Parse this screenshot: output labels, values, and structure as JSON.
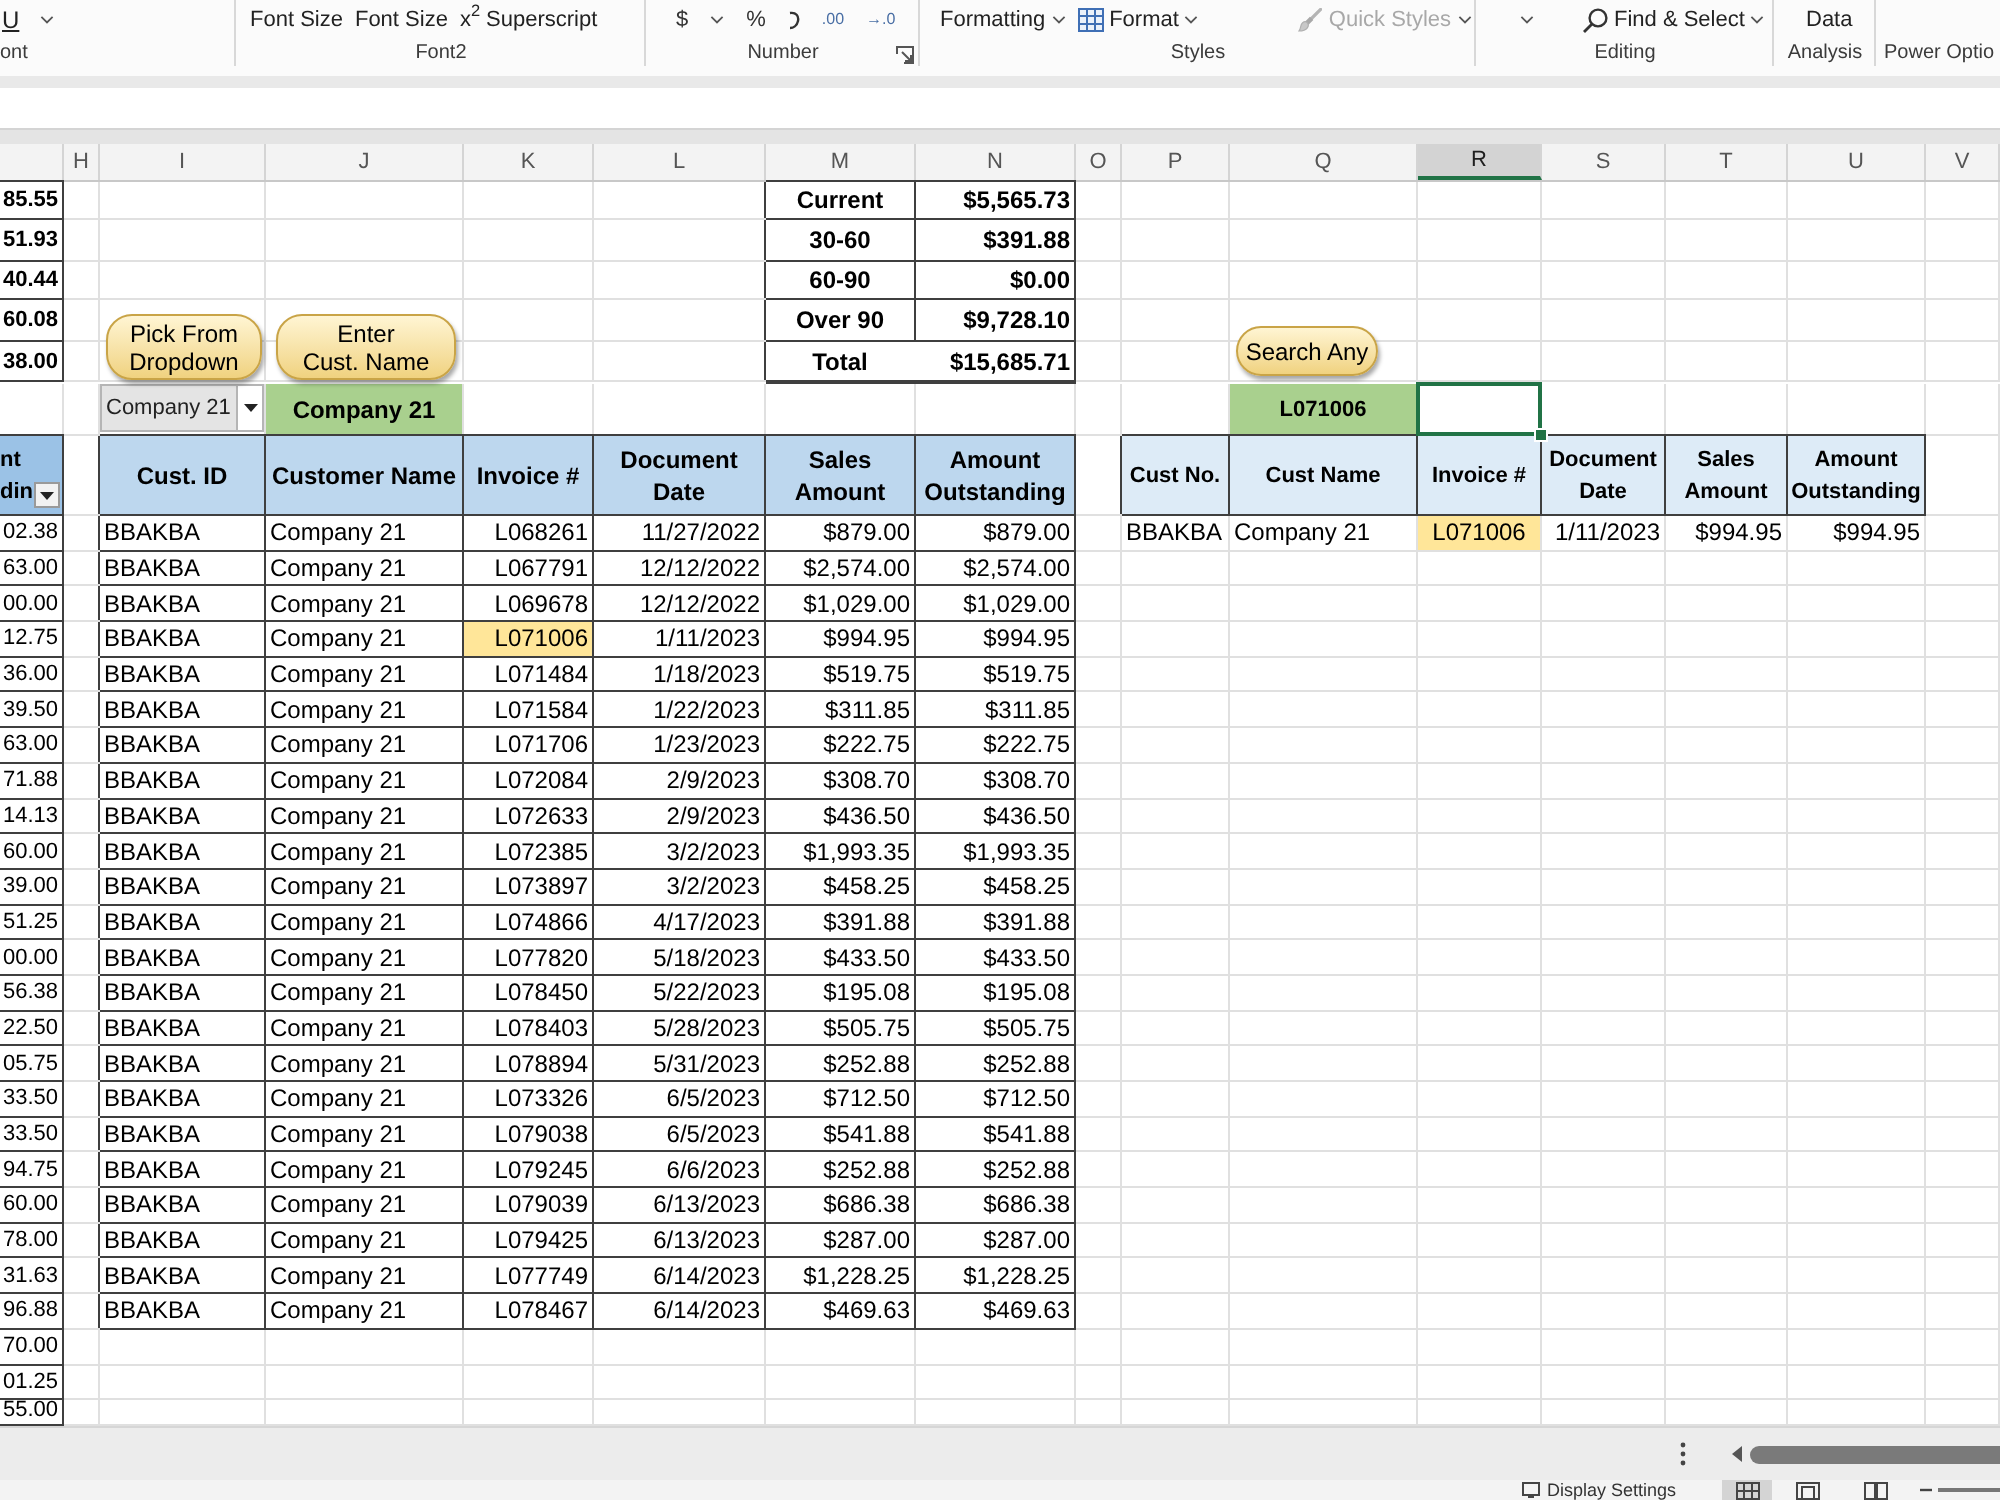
{
  "ribbon": {
    "groups": [
      {
        "label": "ont",
        "controls": [
          {
            "kind": "underline",
            "text": "U"
          },
          {
            "kind": "chevron"
          }
        ]
      },
      {
        "label": "Font2",
        "controls": [
          {
            "kind": "text",
            "text": "Font Size"
          },
          {
            "kind": "text",
            "text": "Font Size"
          },
          {
            "kind": "superscript",
            "glyph": "x$^{2}$",
            "text": "Superscript"
          }
        ]
      },
      {
        "label": "Number",
        "launcher": true,
        "controls": [
          {
            "kind": "glyph",
            "text": "$"
          },
          {
            "kind": "chevron"
          },
          {
            "kind": "glyph",
            "text": "%"
          },
          {
            "kind": "comma"
          },
          {
            "kind": "decimal",
            "text": ".00"
          },
          {
            "kind": "decimal",
            "text": "→.0"
          }
        ]
      },
      {
        "label": "Styles",
        "controls": [
          {
            "kind": "dropdown",
            "text": "Formatting",
            "disabled": false
          },
          {
            "kind": "table-dropdown",
            "text": "Format",
            "disabled": false
          },
          {
            "kind": "brush-dropdown",
            "text": "Quick Styles",
            "disabled": true
          }
        ]
      },
      {
        "label": "Editing",
        "controls": [
          {
            "kind": "chevron"
          },
          {
            "kind": "search-dropdown",
            "text": "Find & Select"
          }
        ]
      },
      {
        "label": "Analysis",
        "controls": [
          {
            "kind": "text",
            "text": "Data"
          }
        ]
      },
      {
        "label": "Power Optio"
      }
    ]
  },
  "columns": [
    {
      "letter": "H",
      "selected": false
    },
    {
      "letter": "I",
      "selected": false
    },
    {
      "letter": "J",
      "selected": false
    },
    {
      "letter": "K",
      "selected": false
    },
    {
      "letter": "L",
      "selected": false
    },
    {
      "letter": "M",
      "selected": false
    },
    {
      "letter": "N",
      "selected": false
    },
    {
      "letter": "O",
      "selected": false
    },
    {
      "letter": "P",
      "selected": false
    },
    {
      "letter": "Q",
      "selected": false
    },
    {
      "letter": "R",
      "selected": true
    },
    {
      "letter": "S",
      "selected": false
    },
    {
      "letter": "T",
      "selected": false
    },
    {
      "letter": "U",
      "selected": false
    },
    {
      "letter": "V",
      "selected": false
    }
  ],
  "left_column": {
    "summary_values": [
      "85.55",
      "51.93",
      "40.44",
      "60.08",
      "38.00"
    ],
    "header": "nt\ndin",
    "values": [
      "02.38",
      "63.00",
      "00.00",
      "12.75",
      "36.00",
      "39.50",
      "63.00",
      "71.88",
      "14.13",
      "60.00",
      "39.00",
      "51.25",
      "00.00",
      "56.38",
      "22.50",
      "05.75",
      "33.50",
      "33.50",
      "94.75",
      "60.00",
      "78.00",
      "31.63",
      "96.88",
      "70.00",
      "01.25",
      "55.00"
    ]
  },
  "aging_summary": [
    {
      "kind": "bucket",
      "label": "Current",
      "amount": "$5,565.73"
    },
    {
      "kind": "bucket",
      "label": "30-60",
      "amount": "$391.88"
    },
    {
      "kind": "bucket",
      "label": "60-90",
      "amount": "$0.00"
    },
    {
      "kind": "bucket",
      "label": "Over 90",
      "amount": "$9,728.10"
    },
    {
      "kind": "total",
      "label": "Total",
      "amount": "$15,685.71"
    }
  ],
  "customer_lookup": {
    "buttons": [
      "Pick From\nDropdown",
      "Enter\nCust. Name"
    ],
    "dropdown_value": "Company 21",
    "name_cell": "Company 21"
  },
  "invoice_search": {
    "button": "Search Any",
    "search_cell": "L071006",
    "input_cell_selected": true
  },
  "customer_table": {
    "columns": [
      "Cust. ID",
      "Customer Name",
      "Invoice #",
      "Document\nDate",
      "Sales\nAmount",
      "Amount\nOutstanding"
    ],
    "rows": [
      {
        "cust_id": "BBAKBA",
        "customer_name": "Company 21",
        "invoice": "L068261",
        "highlighted": false,
        "document_date": "11/27/2022",
        "sales_amount": "$879.00",
        "amount_outstanding": "$879.00"
      },
      {
        "cust_id": "BBAKBA",
        "customer_name": "Company 21",
        "invoice": "L067791",
        "highlighted": false,
        "document_date": "12/12/2022",
        "sales_amount": "$2,574.00",
        "amount_outstanding": "$2,574.00"
      },
      {
        "cust_id": "BBAKBA",
        "customer_name": "Company 21",
        "invoice": "L069678",
        "highlighted": false,
        "document_date": "12/12/2022",
        "sales_amount": "$1,029.00",
        "amount_outstanding": "$1,029.00"
      },
      {
        "cust_id": "BBAKBA",
        "customer_name": "Company 21",
        "invoice": "L071006",
        "highlighted": true,
        "document_date": "1/11/2023",
        "sales_amount": "$994.95",
        "amount_outstanding": "$994.95"
      },
      {
        "cust_id": "BBAKBA",
        "customer_name": "Company 21",
        "invoice": "L071484",
        "highlighted": false,
        "document_date": "1/18/2023",
        "sales_amount": "$519.75",
        "amount_outstanding": "$519.75"
      },
      {
        "cust_id": "BBAKBA",
        "customer_name": "Company 21",
        "invoice": "L071584",
        "highlighted": false,
        "document_date": "1/22/2023",
        "sales_amount": "$311.85",
        "amount_outstanding": "$311.85"
      },
      {
        "cust_id": "BBAKBA",
        "customer_name": "Company 21",
        "invoice": "L071706",
        "highlighted": false,
        "document_date": "1/23/2023",
        "sales_amount": "$222.75",
        "amount_outstanding": "$222.75"
      },
      {
        "cust_id": "BBAKBA",
        "customer_name": "Company 21",
        "invoice": "L072084",
        "highlighted": false,
        "document_date": "2/9/2023",
        "sales_amount": "$308.70",
        "amount_outstanding": "$308.70"
      },
      {
        "cust_id": "BBAKBA",
        "customer_name": "Company 21",
        "invoice": "L072633",
        "highlighted": false,
        "document_date": "2/9/2023",
        "sales_amount": "$436.50",
        "amount_outstanding": "$436.50"
      },
      {
        "cust_id": "BBAKBA",
        "customer_name": "Company 21",
        "invoice": "L072385",
        "highlighted": false,
        "document_date": "3/2/2023",
        "sales_amount": "$1,993.35",
        "amount_outstanding": "$1,993.35"
      },
      {
        "cust_id": "BBAKBA",
        "customer_name": "Company 21",
        "invoice": "L073897",
        "highlighted": false,
        "document_date": "3/2/2023",
        "sales_amount": "$458.25",
        "amount_outstanding": "$458.25"
      },
      {
        "cust_id": "BBAKBA",
        "customer_name": "Company 21",
        "invoice": "L074866",
        "highlighted": false,
        "document_date": "4/17/2023",
        "sales_amount": "$391.88",
        "amount_outstanding": "$391.88"
      },
      {
        "cust_id": "BBAKBA",
        "customer_name": "Company 21",
        "invoice": "L077820",
        "highlighted": false,
        "document_date": "5/18/2023",
        "sales_amount": "$433.50",
        "amount_outstanding": "$433.50"
      },
      {
        "cust_id": "BBAKBA",
        "customer_name": "Company 21",
        "invoice": "L078450",
        "highlighted": false,
        "document_date": "5/22/2023",
        "sales_amount": "$195.08",
        "amount_outstanding": "$195.08"
      },
      {
        "cust_id": "BBAKBA",
        "customer_name": "Company 21",
        "invoice": "L078403",
        "highlighted": false,
        "document_date": "5/28/2023",
        "sales_amount": "$505.75",
        "amount_outstanding": "$505.75"
      },
      {
        "cust_id": "BBAKBA",
        "customer_name": "Company 21",
        "invoice": "L078894",
        "highlighted": false,
        "document_date": "5/31/2023",
        "sales_amount": "$252.88",
        "amount_outstanding": "$252.88"
      },
      {
        "cust_id": "BBAKBA",
        "customer_name": "Company 21",
        "invoice": "L073326",
        "highlighted": false,
        "document_date": "6/5/2023",
        "sales_amount": "$712.50",
        "amount_outstanding": "$712.50"
      },
      {
        "cust_id": "BBAKBA",
        "customer_name": "Company 21",
        "invoice": "L079038",
        "highlighted": false,
        "document_date": "6/5/2023",
        "sales_amount": "$541.88",
        "amount_outstanding": "$541.88"
      },
      {
        "cust_id": "BBAKBA",
        "customer_name": "Company 21",
        "invoice": "L079245",
        "highlighted": false,
        "document_date": "6/6/2023",
        "sales_amount": "$252.88",
        "amount_outstanding": "$252.88"
      },
      {
        "cust_id": "BBAKBA",
        "customer_name": "Company 21",
        "invoice": "L079039",
        "highlighted": false,
        "document_date": "6/13/2023",
        "sales_amount": "$686.38",
        "amount_outstanding": "$686.38"
      },
      {
        "cust_id": "BBAKBA",
        "customer_name": "Company 21",
        "invoice": "L079425",
        "highlighted": false,
        "document_date": "6/13/2023",
        "sales_amount": "$287.00",
        "amount_outstanding": "$287.00"
      },
      {
        "cust_id": "BBAKBA",
        "customer_name": "Company 21",
        "invoice": "L077749",
        "highlighted": false,
        "document_date": "6/14/2023",
        "sales_amount": "$1,228.25",
        "amount_outstanding": "$1,228.25"
      },
      {
        "cust_id": "BBAKBA",
        "customer_name": "Company 21",
        "invoice": "L078467",
        "highlighted": false,
        "document_date": "6/14/2023",
        "sales_amount": "$469.63",
        "amount_outstanding": "$469.63"
      }
    ]
  },
  "search_results": {
    "columns": [
      "Cust No.",
      "Cust Name",
      "Invoice #",
      "Document\nDate",
      "Sales\nAmount",
      "Amount\nOutstanding"
    ],
    "rows": [
      {
        "cust_no": "BBAKBA",
        "cust_name": "Company 21",
        "invoice": "L071006",
        "highlighted": true,
        "document_date": "1/11/2023",
        "sales_amount": "$994.95",
        "amount_outstanding": "$994.95"
      }
    ]
  },
  "status_bar": {
    "display_settings": "Display Settings",
    "views": [
      {
        "kind": "normal",
        "selected": true
      },
      {
        "kind": "page-layout",
        "selected": false
      },
      {
        "kind": "page-break",
        "selected": false
      }
    ]
  }
}
